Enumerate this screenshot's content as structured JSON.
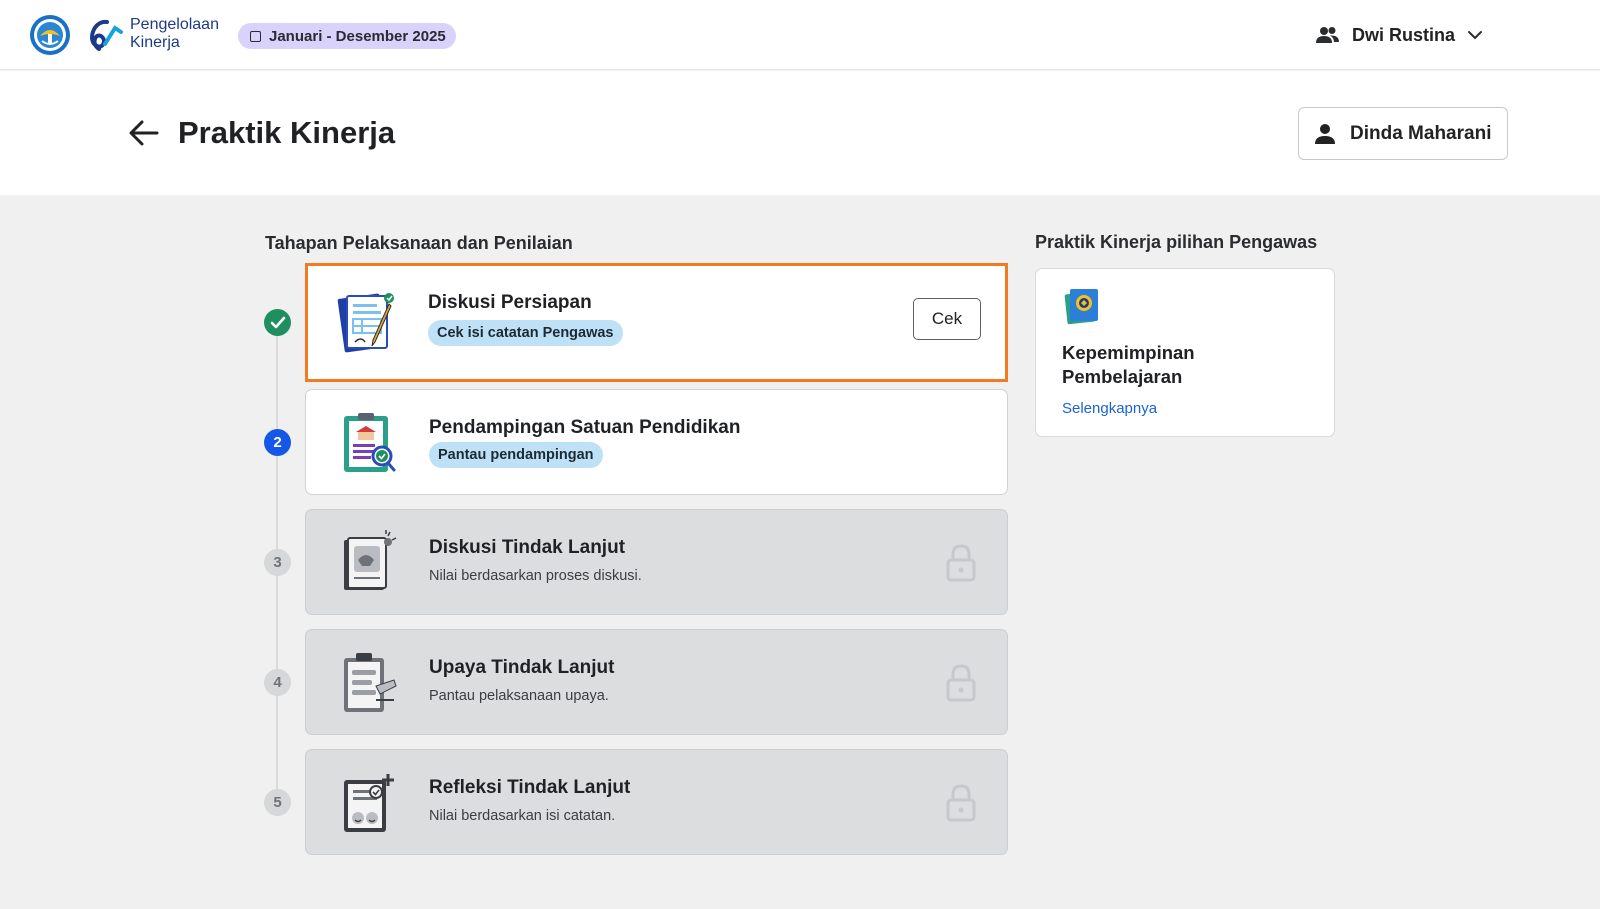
{
  "app": {
    "brand_line1": "Pengelolaan",
    "brand_line2": "Kinerja",
    "period": "Januari - Desember 2025",
    "user_name": "Dwi Rustina"
  },
  "header": {
    "title": "Praktik Kinerja",
    "teacher_name": "Dinda Maharani"
  },
  "stages": {
    "heading": "Tahapan Pelaksanaan dan Penilaian",
    "items": [
      {
        "number": "",
        "status": "done",
        "title": "Diskusi Persiapan",
        "chip": "Cek isi catatan Pengawas",
        "action": "Cek",
        "icon": "document-pen-icon"
      },
      {
        "number": "2",
        "status": "active",
        "title": "Pendampingan Satuan Pendidikan",
        "chip": "Pantau pendampingan",
        "icon": "school-clipboard-icon"
      },
      {
        "number": "3",
        "status": "locked",
        "title": "Diskusi Tindak Lanjut",
        "subtitle": "Nilai berdasarkan proses diskusi.",
        "icon": "discussion-book-icon"
      },
      {
        "number": "4",
        "status": "locked",
        "title": "Upaya Tindak Lanjut",
        "subtitle": "Pantau pelaksanaan upaya.",
        "icon": "clipboard-list-icon"
      },
      {
        "number": "5",
        "status": "locked",
        "title": "Refleksi Tindak Lanjut",
        "subtitle": "Nilai berdasarkan isi catatan.",
        "icon": "reflection-note-icon"
      }
    ]
  },
  "choice": {
    "heading": "Praktik Kinerja pilihan Pengawas",
    "title": "Kepemimpinan Pembelajaran",
    "link": "Selengkapnya",
    "icon": "leadership-book-icon"
  },
  "colors": {
    "accent_blue": "#1557e6",
    "done_green": "#1f8f5f",
    "highlight_orange": "#f07b20",
    "chip_blue": "#bfe1f8",
    "period_chip": "#d9d2fa",
    "link_blue": "#1a63d6"
  }
}
